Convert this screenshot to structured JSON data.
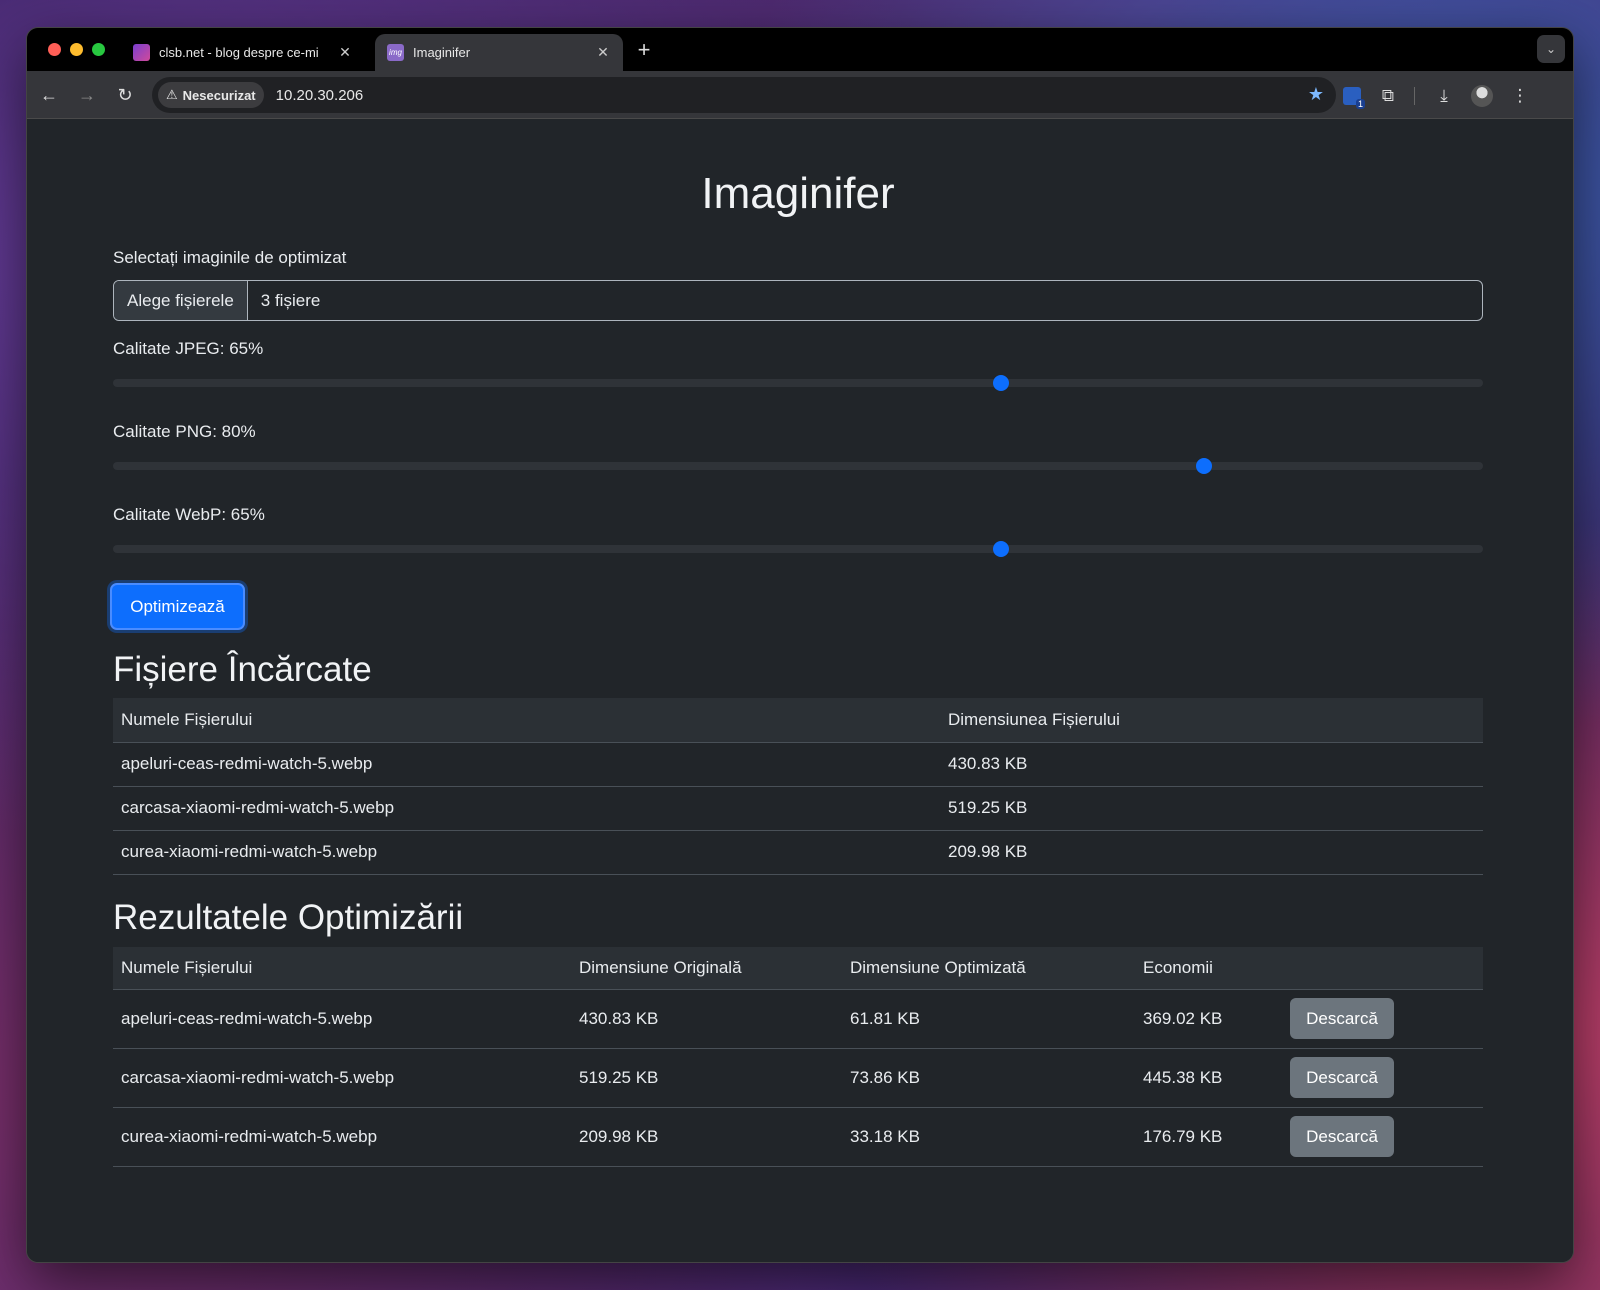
{
  "browser": {
    "tabs": [
      {
        "title": "clsb.net - blog despre ce-mi",
        "favicon": "clsb-favicon",
        "active": false
      },
      {
        "title": "Imaginifer",
        "favicon": "img",
        "active": true
      }
    ],
    "security_label": "Nesecurizat",
    "url": "10.20.30.206"
  },
  "page": {
    "title": "Imaginifer",
    "file_label": "Selectați imaginile de optimizat",
    "file_button": "Alege fișierele",
    "file_value": "3 fișiere",
    "sliders": [
      {
        "label": "Calitate JPEG: 65%",
        "value": 65
      },
      {
        "label": "Calitate PNG: 80%",
        "value": 80
      },
      {
        "label": "Calitate WebP: 65%",
        "value": 65
      }
    ],
    "optimize_button": "Optimizează",
    "uploaded": {
      "heading": "Fișiere Încărcate",
      "columns": [
        "Numele Fișierului",
        "Dimensiunea Fișierului"
      ],
      "rows": [
        [
          "apeluri-ceas-redmi-watch-5.webp",
          "430.83 KB"
        ],
        [
          "carcasa-xiaomi-redmi-watch-5.webp",
          "519.25 KB"
        ],
        [
          "curea-xiaomi-redmi-watch-5.webp",
          "209.98 KB"
        ]
      ]
    },
    "results": {
      "heading": "Rezultatele Optimizării",
      "columns": [
        "Numele Fișierului",
        "Dimensiune Originală",
        "Dimensiune Optimizată",
        "Economii"
      ],
      "download_label": "Descarcă",
      "rows": [
        [
          "apeluri-ceas-redmi-watch-5.webp",
          "430.83 KB",
          "61.81 KB",
          "369.02 KB"
        ],
        [
          "carcasa-xiaomi-redmi-watch-5.webp",
          "519.25 KB",
          "73.86 KB",
          "445.38 KB"
        ],
        [
          "curea-xiaomi-redmi-watch-5.webp",
          "209.98 KB",
          "33.18 KB",
          "176.79 KB"
        ]
      ]
    }
  },
  "colors": {
    "accent": "#0d6efd",
    "secondary": "#6c757d",
    "background": "#212529"
  }
}
